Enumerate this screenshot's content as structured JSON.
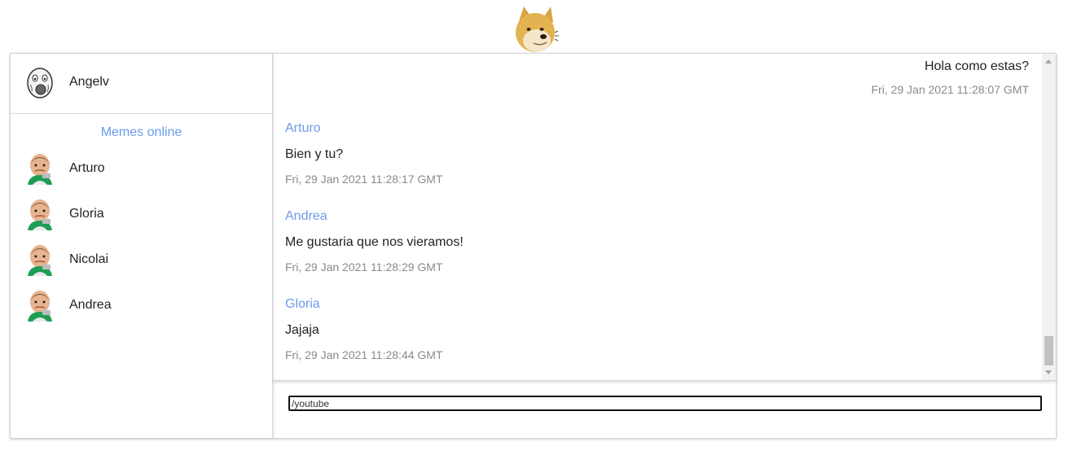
{
  "header": {
    "logo_icon": "doge-logo-icon"
  },
  "current_user": {
    "name": "Angelv",
    "avatar_icon": "trollface-avatar-icon"
  },
  "online": {
    "title": "Memes online",
    "users": [
      {
        "name": "Arturo",
        "avatar_icon": "success-kid-avatar-icon"
      },
      {
        "name": "Gloria",
        "avatar_icon": "success-kid-avatar-icon"
      },
      {
        "name": "Nicolai",
        "avatar_icon": "success-kid-avatar-icon"
      },
      {
        "name": "Andrea",
        "avatar_icon": "success-kid-avatar-icon"
      }
    ]
  },
  "messages": [
    {
      "own": true,
      "text": "Hola como estas?",
      "time": "Fri, 29 Jan 2021 11:28:07 GMT"
    },
    {
      "author": "Arturo",
      "text": "Bien y tu?",
      "time": "Fri, 29 Jan 2021 11:28:17 GMT"
    },
    {
      "author": "Andrea",
      "text": "Me gustaria que nos vieramos!",
      "time": "Fri, 29 Jan 2021 11:28:29 GMT"
    },
    {
      "author": "Gloria",
      "text": "Jajaja",
      "time": "Fri, 29 Jan 2021 11:28:44 GMT"
    }
  ],
  "composer": {
    "value": "/youtube",
    "placeholder": ""
  },
  "colors": {
    "accent": "#6b9bea",
    "timestamp": "#8a8a8a"
  }
}
